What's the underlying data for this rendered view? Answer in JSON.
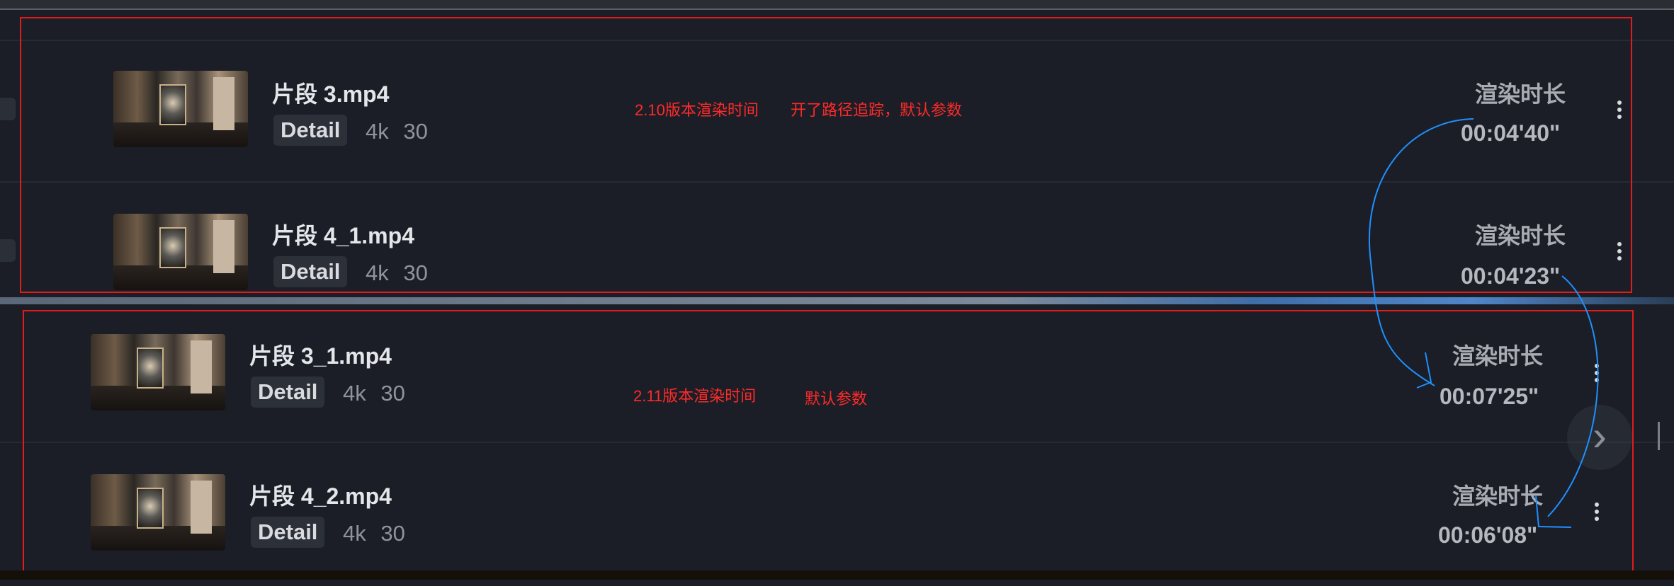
{
  "window": {
    "corner_button_label": "⛶"
  },
  "colors": {
    "annotation_red": "#e31b1b",
    "annotation_blue": "#1e90ff",
    "panel_bg": "#1b1e26"
  },
  "panels": [
    {
      "note_version": "2.10版本渲染时间",
      "note_setting": "开了路径追踪，默认参数",
      "rows": [
        {
          "filename": "片段 3.mp4",
          "tag": "Detail",
          "resolution": "4k",
          "fps": "30",
          "duration_label": "渲染时长",
          "duration": "00:04'40\""
        },
        {
          "filename": "片段 4_1.mp4",
          "tag": "Detail",
          "resolution": "4k",
          "fps": "30",
          "duration_label": "渲染时长",
          "duration": "00:04'23\""
        }
      ]
    },
    {
      "note_version": "2.11版本渲染时间",
      "note_setting": "默认参数",
      "rows": [
        {
          "filename": "片段 3_1.mp4",
          "tag": "Detail",
          "resolution": "4k",
          "fps": "30",
          "duration_label": "渲染时长",
          "duration": "00:07'25\""
        },
        {
          "filename": "片段 4_2.mp4",
          "tag": "Detail",
          "resolution": "4k",
          "fps": "30",
          "duration_label": "渲染时长",
          "duration": "00:06'08\""
        }
      ]
    }
  ],
  "nav": {
    "next_icon": "›"
  }
}
